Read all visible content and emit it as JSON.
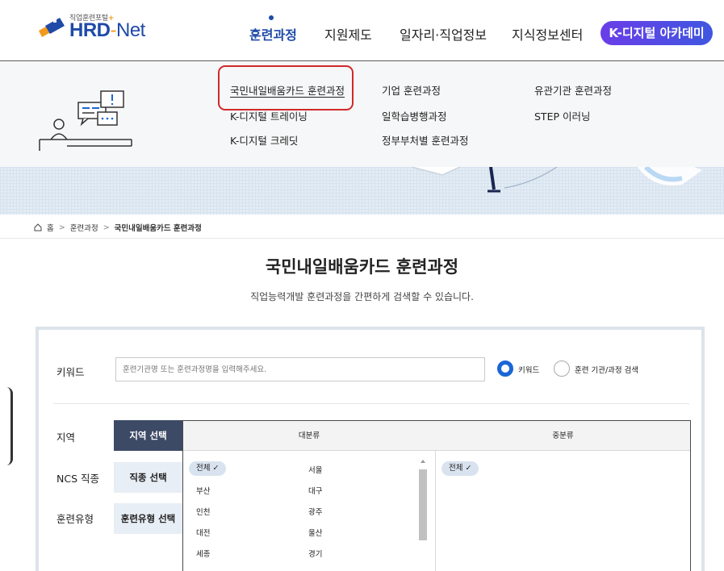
{
  "header": {
    "logo_tagline": "직업훈련포털",
    "logo_tagline_plus": "+",
    "logo_hrd": "HRD",
    "logo_dash": "-",
    "logo_net": "Net",
    "nav": [
      "훈련과정",
      "지원제도",
      "일자리·직업정보",
      "지식정보센터"
    ],
    "academy_label": "K-디지털 아카데미"
  },
  "megamenu": {
    "col1": [
      "국민내일배움카드 훈련과정",
      "K-디지털 트레이닝",
      "K-디지털 크레딧"
    ],
    "col2": [
      "기업 훈련과정",
      "일학습병행과정",
      "정부부처별 훈련과정"
    ],
    "col3": [
      "유관기관 훈련과정",
      "STEP 이러닝"
    ]
  },
  "breadcrumb": {
    "home": "홈",
    "sep": ">",
    "level1": "훈련과정",
    "current": "국민내일배움카드 훈련과정"
  },
  "page": {
    "title": "국민내일배움카드 훈련과정",
    "subtitle": "직업능력개발 훈련과정을 간편하게 검색할 수 있습니다."
  },
  "search": {
    "keyword_label": "키워드",
    "keyword_placeholder": "훈련기관명 또는 훈련과정명을 입력해주세요.",
    "radio_keyword": "키워드",
    "radio_institution": "훈련 기관/과정 검색",
    "rows": [
      {
        "label": "지역",
        "button": "지역 선택",
        "active": true
      },
      {
        "label": "NCS 직종",
        "button": "직종 선택",
        "active": false
      },
      {
        "label": "훈련유형",
        "button": "훈련유형 선택",
        "active": false
      }
    ],
    "region_table": {
      "major_header": "대분류",
      "minor_header": "중분류",
      "major_col_a": [
        "전체 ✓",
        "부산",
        "인천",
        "대전",
        "세종"
      ],
      "major_col_b": [
        "서울",
        "대구",
        "광주",
        "울산",
        "경기"
      ],
      "minor_items": [
        "전체 ✓"
      ]
    }
  },
  "colors": {
    "brand_blue": "#1f4aa8",
    "accent_orange": "#f29a1d",
    "highlight_red": "#d02a2a",
    "radio_blue": "#1b66d6",
    "active_button": "#3d4a66"
  }
}
